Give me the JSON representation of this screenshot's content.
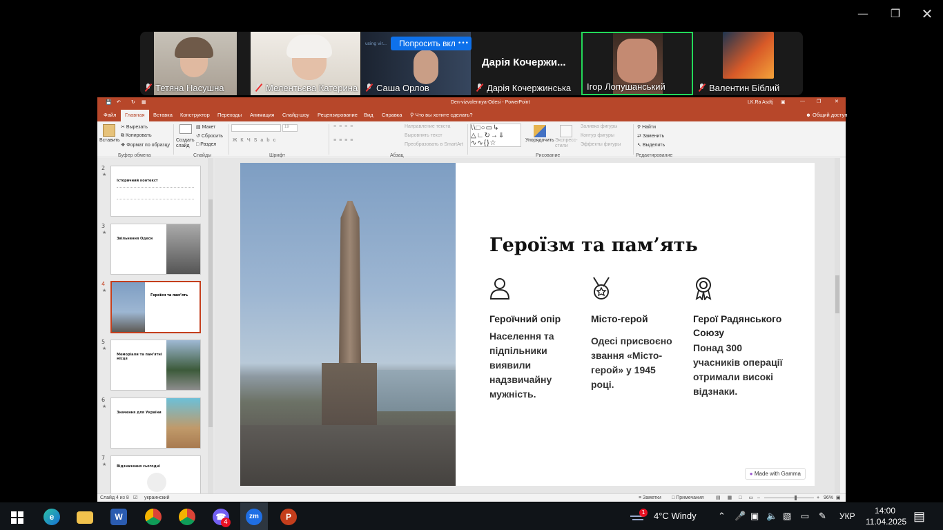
{
  "zoom_meeting": {
    "request_button": "Попросить вкл",
    "more_button": "•••",
    "participants": [
      {
        "name": "Тетяна Насушна",
        "muted": true
      },
      {
        "name": "Мелентьєва Катерина",
        "muted": true
      },
      {
        "name": "Саша Орлов",
        "muted": true
      },
      {
        "name": "Дарія Кочержинська",
        "muted": true,
        "display_text": "Дарія  Кочержи..."
      },
      {
        "name": "Ігор Лопушанський",
        "muted": false,
        "active_speaker": true
      },
      {
        "name": "Валентин Біблий",
        "muted": true
      }
    ],
    "overlay_text": "using vir..."
  },
  "powerpoint": {
    "title": "Den-vizvolennya-Odesi  -  PowerPoint",
    "user": "LK.Ra Asdtj",
    "share": "Общий доступ",
    "menu": [
      "Файл",
      "Главная",
      "Вставка",
      "Конструктор",
      "Переходы",
      "Анимация",
      "Слайд-шоу",
      "Рецензирование",
      "Вид",
      "Справка"
    ],
    "tell_me": "Что вы хотите сделать?",
    "ribbon": {
      "paste": "Вставить",
      "cut": "Вырезать",
      "copy": "Копировать",
      "format_painter": "Формат по образцу",
      "clipboard_group": "Буфер обмена",
      "new_slide": "Создать слайд",
      "layout": "Макет",
      "reset": "Сбросить",
      "section": "Раздел",
      "slides_group": "Слайды",
      "font_group": "Шрифт",
      "font_size": "19",
      "paragraph_group": "Абзац",
      "text_direction": "Направление текста",
      "align_text": "Выровнять текст",
      "smartart": "Преобразовать в SmartArt",
      "drawing_group": "Рисование",
      "arrange": "Упорядочить",
      "quick_styles": "Экспресс-стили",
      "shape_fill": "Заливка фигуры",
      "shape_outline": "Контур фигуры",
      "shape_effects": "Эффекты фигуры",
      "find": "Найти",
      "replace": "Заменить",
      "select": "Выделить",
      "editing_group": "Редактирование"
    },
    "thumbnails": [
      {
        "num": "2",
        "title": "Історичний контекст"
      },
      {
        "num": "3",
        "title": "Звільнення Одеси"
      },
      {
        "num": "4",
        "title": "Героїзм та пам’ять"
      },
      {
        "num": "5",
        "title": "Меморіали та пам’ятні місця"
      },
      {
        "num": "6",
        "title": "Значення для України"
      },
      {
        "num": "7",
        "title": "Відзначення сьогодні"
      }
    ],
    "slide": {
      "title": "Героїзм та пам’ять",
      "columns": [
        {
          "icon": "person-icon",
          "heading": "Героїчний опір",
          "text": "Населення та підпільники виявили надзвичайну мужність."
        },
        {
          "icon": "medal-icon",
          "heading": "Місто-герой",
          "text": "Одесі присвоєно звання «Місто-герой» у 1945 році."
        },
        {
          "icon": "award-icon",
          "heading": "Герої Радянського Союзу",
          "text": "Понад 300 учасників операції отримали високі відзнаки."
        }
      ],
      "badge": "Made with Gamma"
    },
    "status": {
      "slide_of": "Слайд 4 из 8",
      "language": "украинский",
      "notes": "Заметки",
      "comments": "Примечания",
      "zoom": "96%"
    }
  },
  "taskbar": {
    "weather_temp": "4°C",
    "weather_text": "Windy",
    "weather_badge": "1",
    "viber_badge": "4",
    "language": "УКР",
    "time": "14:00",
    "date": "11.04.2025"
  }
}
